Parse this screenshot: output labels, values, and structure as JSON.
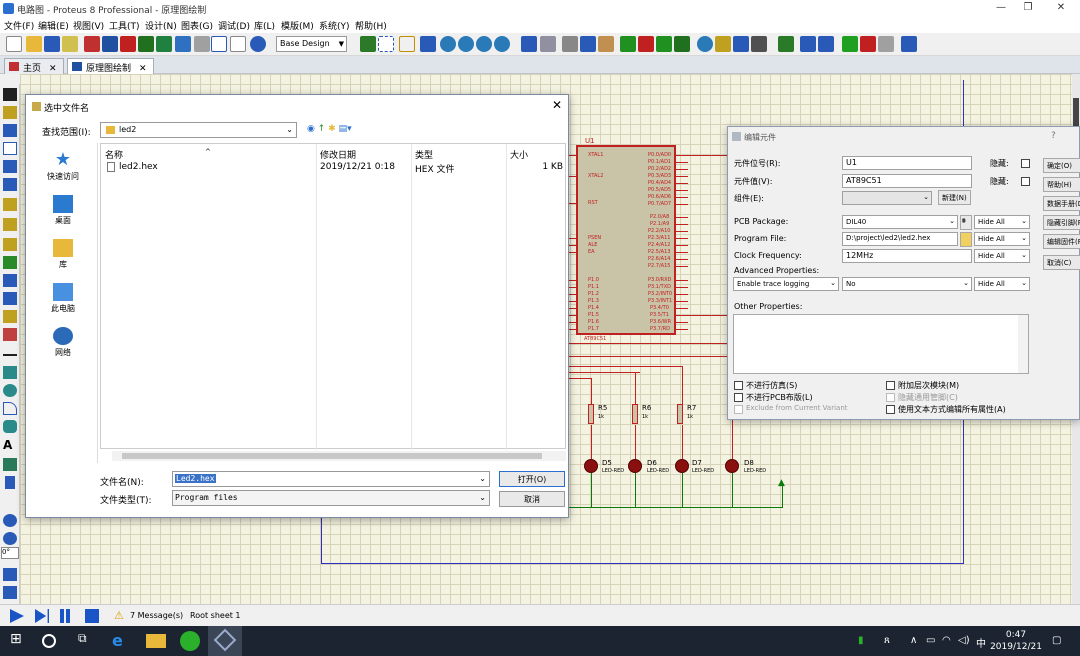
{
  "window": {
    "title": "电路图 - Proteus 8 Professional - 原理图绘制"
  },
  "menu": [
    "文件(F)",
    "编辑(E)",
    "视图(V)",
    "工具(T)",
    "设计(N)",
    "图表(G)",
    "调试(D)",
    "库(L)",
    "模版(M)",
    "系统(Y)",
    "帮助(H)"
  ],
  "toolbar": {
    "design_combo": "Base Design"
  },
  "tabs": [
    {
      "label": "主页",
      "close": "✕"
    },
    {
      "label": "原理图绘制",
      "close": "✕"
    }
  ],
  "file_dialog": {
    "title": "选中文件名",
    "look_in_label": "查找范围(I):",
    "look_in_value": "led2",
    "places": [
      "快速访问",
      "桌面",
      "库",
      "此电脑",
      "网络"
    ],
    "columns": [
      "名称",
      "修改日期",
      "类型",
      "大小"
    ],
    "files": [
      {
        "name": "led2.hex",
        "date": "2019/12/21 0:18",
        "type": "HEX 文件",
        "size": "1 KB"
      }
    ],
    "filename_label": "文件名(N):",
    "filename_value": "Led2.hex",
    "filetype_label": "文件类型(T):",
    "filetype_value": "Program files",
    "open_button": "打开(O)",
    "cancel_button": "取消"
  },
  "schematic": {
    "chip_ref": "U1",
    "chip_part": "AT89C51",
    "chip_left_pins": [
      "XTAL1",
      "XTAL2",
      "RST",
      "PSEN",
      "ALE",
      "EA",
      "P1.0",
      "P1.1",
      "P1.2",
      "P1.3",
      "P1.4",
      "P1.5",
      "P1.6",
      "P1.7"
    ],
    "chip_right_pins": [
      "P0.0/AD0",
      "P0.1/AD1",
      "P0.2/AD2",
      "P0.3/AD3",
      "P0.4/AD4",
      "P0.5/AD5",
      "P0.6/AD6",
      "P0.7/AD7",
      "P2.0/A8",
      "P2.1/A9",
      "P2.2/A10",
      "P2.3/A11",
      "P2.4/A12",
      "P2.5/A13",
      "P2.6/A14",
      "P2.7/A15",
      "P3.0/RXD",
      "P3.1/TXD",
      "P3.2/INT0",
      "P3.3/INT1",
      "P3.4/T0",
      "P3.5/T1",
      "P3.6/WR",
      "P3.7/RD"
    ],
    "resistors": [
      {
        "ref": "R5",
        "value": "1k"
      },
      {
        "ref": "R6",
        "value": "1k"
      },
      {
        "ref": "R7",
        "value": "1k"
      }
    ],
    "leds": [
      {
        "ref": "D5",
        "type": "LED-RED"
      },
      {
        "ref": "D6",
        "type": "LED-RED"
      },
      {
        "ref": "D7",
        "type": "LED-RED"
      },
      {
        "ref": "D8",
        "type": "LED-RED"
      }
    ]
  },
  "edit_dialog": {
    "title": "编辑元件",
    "help_mark": "?",
    "ref_label": "元件位号(R):",
    "ref_value": "U1",
    "value_label": "元件值(V):",
    "value_value": "AT89C51",
    "group_label": "组件(E):",
    "new_button": "新建(N)",
    "hidden_label": "隐藏:",
    "pcb_label": "PCB Package:",
    "pcb_value": "DIL40",
    "prog_label": "Program File:",
    "prog_value": "D:\\project\\led2\\led2.hex",
    "clock_label": "Clock Frequency:",
    "clock_value": "12MHz",
    "hide_all": "Hide All",
    "adv_label": "Advanced Properties:",
    "adv_prop": "Enable trace logging",
    "adv_value": "No",
    "other_label": "Other Properties:",
    "chk_nosim": "不进行仿真(S)",
    "chk_nopcb": "不进行PCB布版(L)",
    "chk_exclude": "Exclude from Current Variant",
    "chk_hier": "附加层次模块(M)",
    "chk_hidepins": "隐藏通用管脚(C)",
    "chk_textedit": "使用文本方式编辑所有属性(A)",
    "right_buttons": [
      "确定(O)",
      "帮助(H)",
      "数据手册(D)",
      "隐藏引脚(P)",
      "编辑固件(F)",
      "取消(C)"
    ]
  },
  "statusbar": {
    "messages": "7 Message(s)",
    "sheet": "Root sheet 1"
  },
  "palette": {
    "rotation": "0°"
  },
  "taskbar": {
    "time": "0:47",
    "date": "2019/12/21",
    "ime": "中"
  }
}
